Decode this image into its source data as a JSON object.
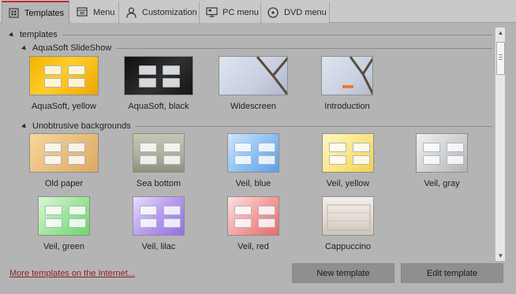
{
  "tabs": [
    {
      "label": "Templates",
      "icon": "templates-icon",
      "active": true
    },
    {
      "label": "Menu",
      "icon": "menu-icon",
      "active": false
    },
    {
      "label": "Customization",
      "icon": "person-icon",
      "active": false
    },
    {
      "label": "PC menu",
      "icon": "monitor-icon",
      "active": false
    },
    {
      "label": "DVD menu",
      "icon": "disc-icon",
      "active": false
    }
  ],
  "root_group": {
    "label": "templates"
  },
  "groups": [
    {
      "label": "AquaSoft SlideShow",
      "items": [
        {
          "label": "AquaSoft, yellow"
        },
        {
          "label": "AquaSoft, black"
        },
        {
          "label": "Widescreen"
        },
        {
          "label": "Introduction"
        }
      ]
    },
    {
      "label": "Unobtrusive backgrounds",
      "items": [
        {
          "label": "Old paper"
        },
        {
          "label": "Sea bottom"
        },
        {
          "label": "Veil, blue"
        },
        {
          "label": "Veil, yellow"
        },
        {
          "label": "Veil, gray"
        },
        {
          "label": "Veil, green"
        },
        {
          "label": "Veil, lilac"
        },
        {
          "label": "Veil, red"
        },
        {
          "label": "Cappuccino"
        }
      ]
    }
  ],
  "more_link": "More templates on the Internet...",
  "buttons": {
    "new_template": "New template",
    "edit_template": "Edit template"
  },
  "colors": {
    "active_tab_accent": "#c02a2a",
    "link": "#8a1f1f",
    "button_bg": "#8f8f8f"
  }
}
